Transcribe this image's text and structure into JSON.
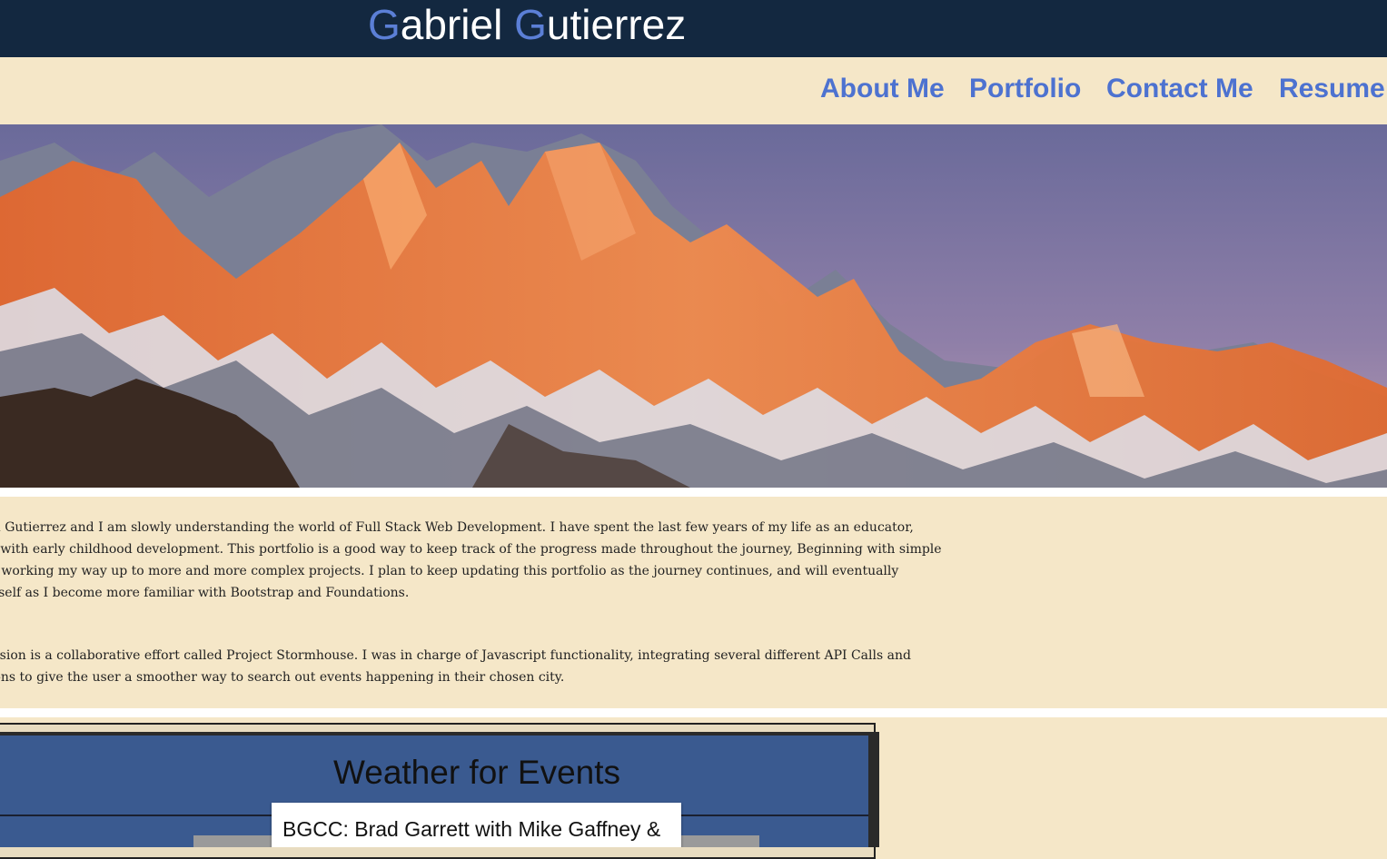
{
  "header": {
    "title_parts": [
      {
        "initial": "G",
        "rest": "abriel "
      },
      {
        "initial": "G",
        "rest": "utierrez"
      }
    ]
  },
  "nav": {
    "items": [
      "About Me",
      "Portfolio",
      "Contact Me",
      "Resume"
    ]
  },
  "about": {
    "paragraph1_lines": [
      "el Gutierrez and I am slowly understanding the world of Full Stack Web Development. I have spent the last few years of my life as an educator,",
      "y with early childhood development. This portfolio is a good way to keep track of the progress made throughout the journey, Beginning with simple",
      "d working my way up to more and more complex projects. I plan to keep updating this portfolio as the journey continues, and will eventually",
      " itself as I become more familiar with Bootstrap and Foundations."
    ],
    "paragraph2_lines": [
      "ission is a collaborative effort called Project Stormhouse. I was in charge of Javascript functionality, integrating several different API Calls and",
      "ions to give the user a smoother way to search out events happening in their chosen city."
    ]
  },
  "portfolio": {
    "project_heading": "Weather for Events",
    "popup_text": "BGCC: Brad Garrett with Mike Gaffney &"
  },
  "colors": {
    "header_bg": "#132840",
    "accent": "#5b7fd6",
    "page_bg": "#f5e7c8",
    "nav_link": "#4d72d0"
  }
}
